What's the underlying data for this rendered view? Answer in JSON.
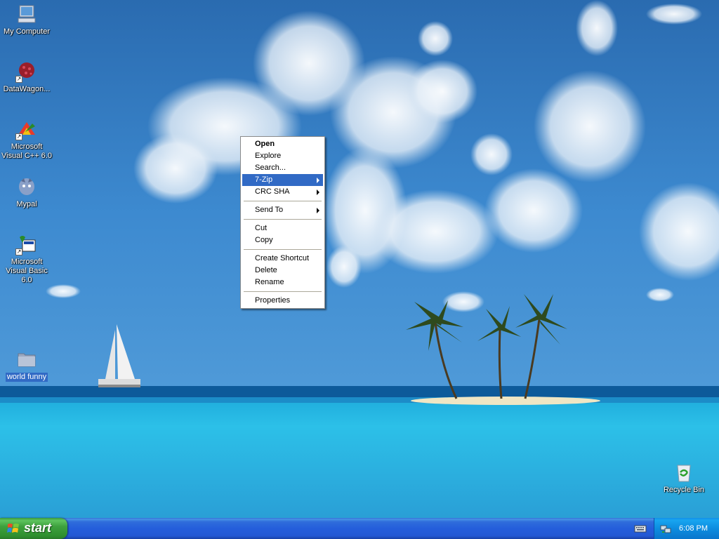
{
  "desktop": {
    "icons": [
      {
        "label": "My Computer",
        "icon": "my-computer-icon"
      },
      {
        "label": "DataWagon...",
        "icon": "datawagon-icon"
      },
      {
        "label": "Microsoft Visual C++ 6.0",
        "icon": "visual-cpp-icon"
      },
      {
        "label": "Mypal",
        "icon": "mypal-icon"
      },
      {
        "label": "Microsoft Visual Basic 6.0",
        "icon": "visual-basic-icon"
      },
      {
        "label": "world funny",
        "icon": "folder-icon",
        "selected": true
      },
      {
        "label": "Recycle Bin",
        "icon": "recycle-bin-icon"
      }
    ]
  },
  "context_menu": {
    "items": [
      {
        "label": "Open",
        "bold": true
      },
      {
        "label": "Explore"
      },
      {
        "label": "Search..."
      },
      {
        "label": "7-Zip",
        "submenu": true,
        "highlighted": true
      },
      {
        "label": "CRC SHA",
        "submenu": true
      },
      {
        "label": "Send To",
        "submenu": true
      },
      {
        "label": "Cut"
      },
      {
        "label": "Copy"
      },
      {
        "label": "Create Shortcut"
      },
      {
        "label": "Delete"
      },
      {
        "label": "Rename"
      },
      {
        "label": "Properties"
      }
    ]
  },
  "taskbar": {
    "start_label": "start",
    "clock": "6:08 PM",
    "tray_icons": [
      "keyboard-icon",
      "network-icon"
    ]
  },
  "colors": {
    "highlight": "#316ac5",
    "taskbar": "#245edb",
    "start_button": "#3ea13e"
  }
}
